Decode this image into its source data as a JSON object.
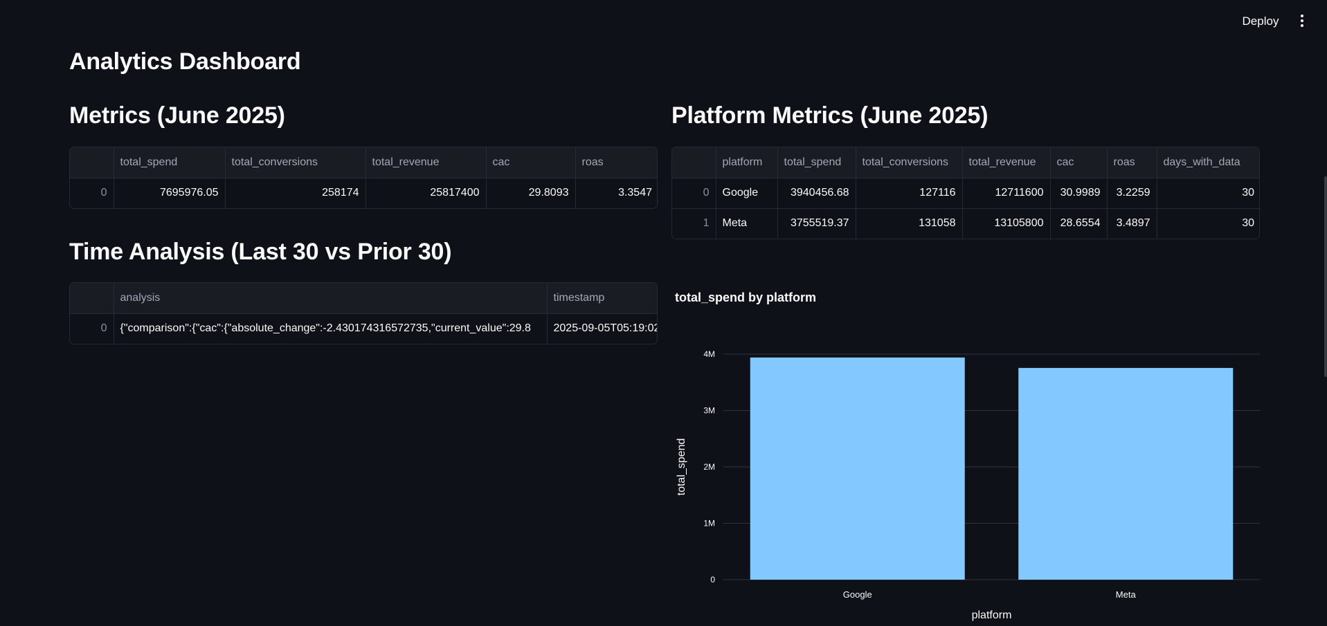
{
  "header": {
    "deploy_label": "Deploy",
    "menu_icon": "more-vertical-icon"
  },
  "page_title": "Analytics Dashboard",
  "metrics": {
    "title": "Metrics (June 2025)",
    "columns": [
      "",
      "total_spend",
      "total_conversions",
      "total_revenue",
      "cac",
      "roas"
    ],
    "rows": [
      [
        "0",
        "7695976.05",
        "258174",
        "25817400",
        "29.8093",
        "3.3547"
      ]
    ]
  },
  "platform_metrics": {
    "title": "Platform Metrics (June 2025)",
    "columns": [
      "",
      "platform",
      "total_spend",
      "total_conversions",
      "total_revenue",
      "cac",
      "roas",
      "days_with_data"
    ],
    "rows": [
      [
        "0",
        "Google",
        "3940456.68",
        "127116",
        "12711600",
        "30.9989",
        "3.2259",
        "30"
      ],
      [
        "1",
        "Meta",
        "3755519.37",
        "131058",
        "13105800",
        "28.6554",
        "3.4897",
        "30"
      ]
    ]
  },
  "time_analysis": {
    "title": "Time Analysis (Last 30 vs Prior 30)",
    "columns": [
      "",
      "analysis",
      "timestamp"
    ],
    "rows": [
      [
        "0",
        "{\"comparison\":{\"cac\":{\"absolute_change\":-2.430174316572735,\"current_value\":29.8",
        "2025-09-05T05:19:02"
      ]
    ]
  },
  "chart_data": {
    "type": "bar",
    "title": "total_spend by platform",
    "xlabel": "platform",
    "ylabel": "total_spend",
    "categories": [
      "Google",
      "Meta"
    ],
    "values": [
      3940456.68,
      3755519.37
    ],
    "ylim": [
      0,
      4000000
    ],
    "yticks": [
      0,
      1000000,
      2000000,
      3000000,
      4000000
    ],
    "ytick_labels": [
      "0",
      "1M",
      "2M",
      "3M",
      "4M"
    ],
    "bar_color": "#83c9ff",
    "grid_color": "#31333f",
    "grid": true
  }
}
